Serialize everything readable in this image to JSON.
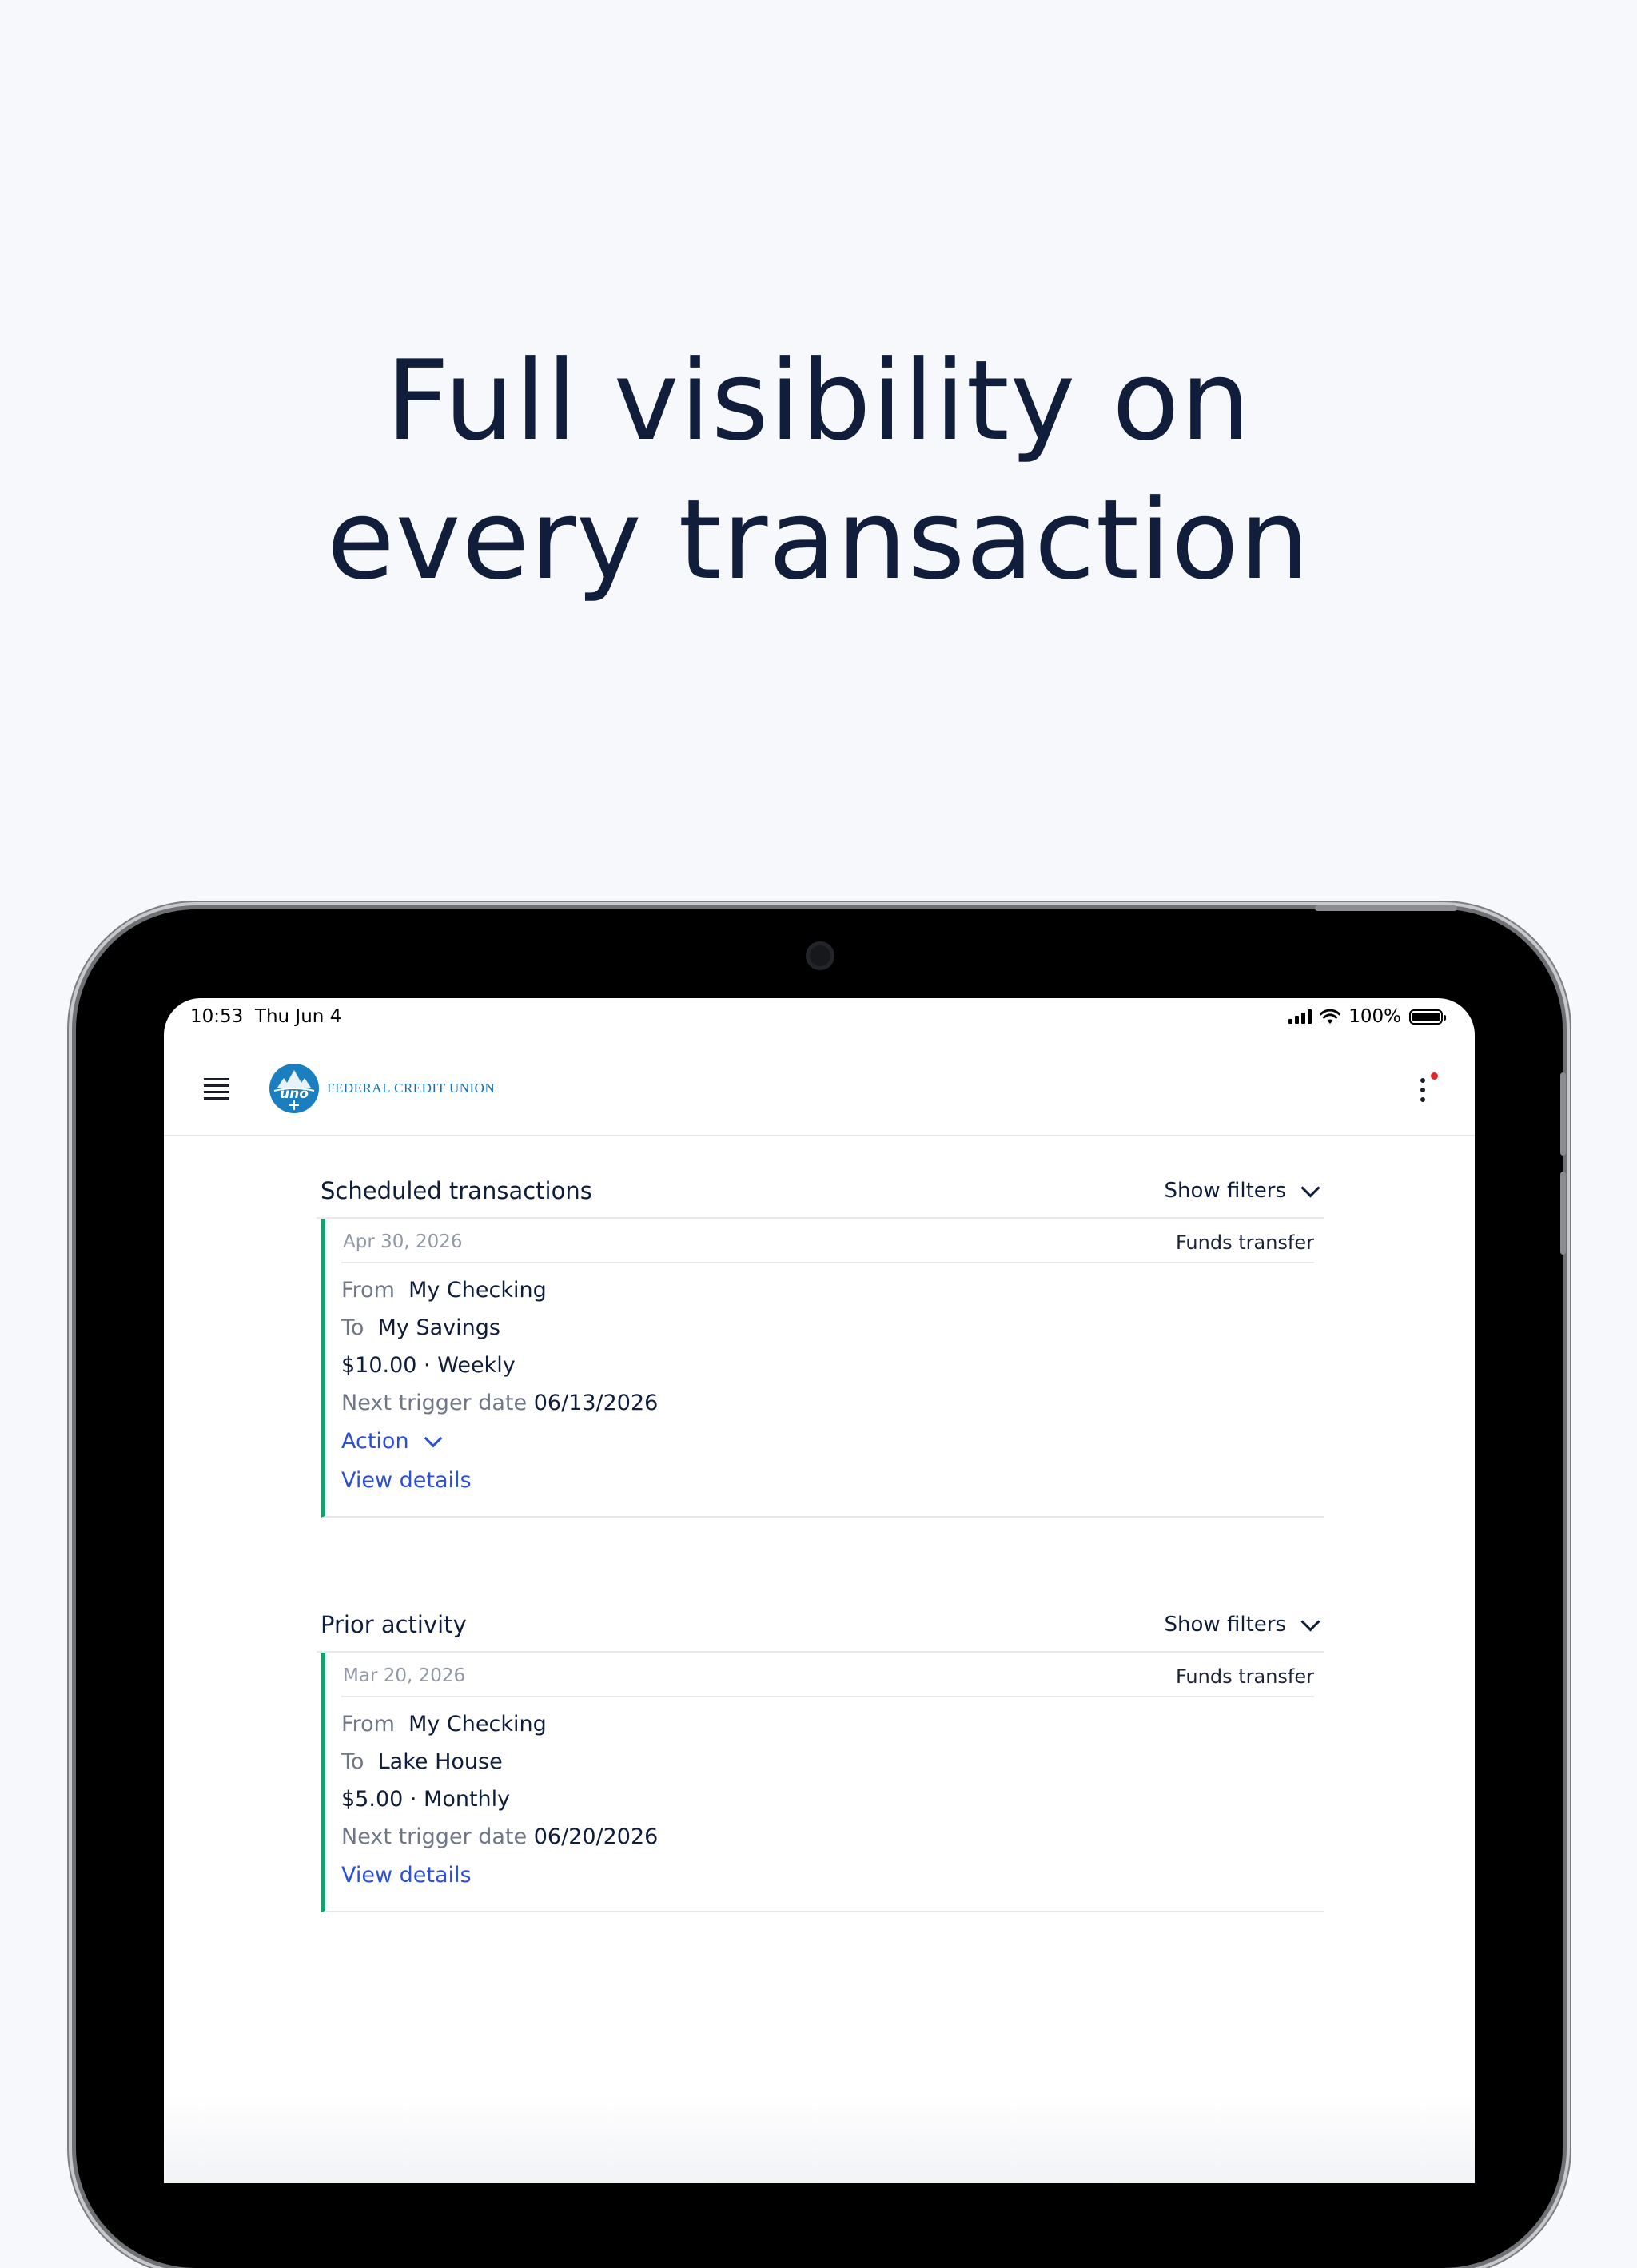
{
  "headline": {
    "line1": "Full visibility on",
    "line2": "every transaction"
  },
  "status_bar": {
    "time": "10:53",
    "date": "Thu Jun 4",
    "battery": "100%"
  },
  "app_header": {
    "logo_text": "FEDERAL CREDIT UNION",
    "logo_mark": "uno"
  },
  "scheduled": {
    "title": "Scheduled transactions",
    "filters_label": "Show filters",
    "transaction": {
      "date": "Apr 30, 2026",
      "type": "Funds transfer",
      "from_label": "From",
      "from_value": "My Checking",
      "to_label": "To",
      "to_value": "My Savings",
      "amount_freq": "$10.00 · Weekly",
      "next_label": "Next trigger date",
      "next_value": "06/13/2026",
      "action_label": "Action",
      "details_label": "View details"
    }
  },
  "prior": {
    "title": "Prior activity",
    "filters_label": "Show filters",
    "transaction": {
      "date": "Mar 20, 2026",
      "type": "Funds transfer",
      "from_label": "From",
      "from_value": "My Checking",
      "to_label": "To",
      "to_value": "Lake House",
      "amount_freq": "$5.00 · Monthly",
      "next_label": "Next trigger date",
      "next_value": "06/20/2026",
      "details_label": "View details"
    }
  },
  "colors": {
    "accent_green": "#16a06c",
    "link_blue": "#2b4fd8",
    "navy": "#0f1d3a",
    "notification_red": "#e0262b"
  }
}
